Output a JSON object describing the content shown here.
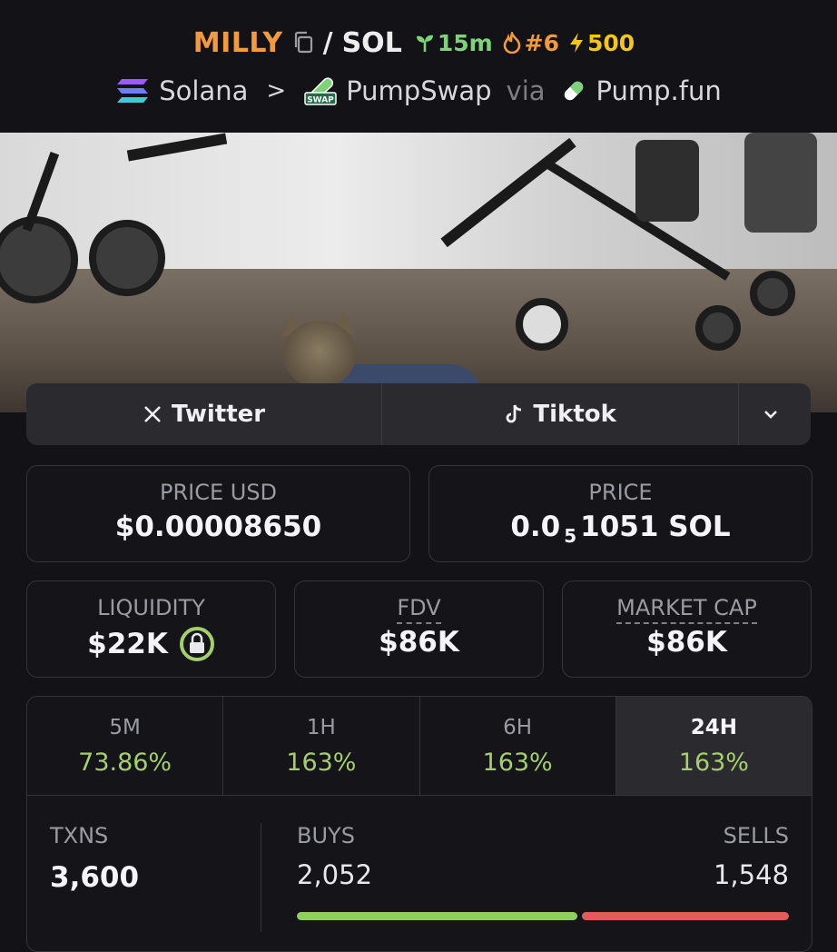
{
  "header": {
    "token_symbol": "MILLY",
    "separator": "/",
    "quote_symbol": "SOL",
    "age_badge": "15m",
    "rank_badge": "#6",
    "boost_badge": "500",
    "chain": "Solana",
    "dex": "PumpSwap",
    "via_label": "via",
    "launchpad": "Pump.fun",
    "swap_icon_text": "SWAP"
  },
  "socials": {
    "twitter_label": "Twitter",
    "tiktok_label": "Tiktok"
  },
  "metrics": {
    "price_usd_label": "PRICE USD",
    "price_usd_value": "$0.00008650",
    "price_label": "PRICE",
    "price_prefix": "0.0",
    "price_subscript": "5",
    "price_suffix": "1051 SOL",
    "liquidity_label": "LIQUIDITY",
    "liquidity_value": "$22K",
    "fdv_label": "FDV",
    "fdv_value": "$86K",
    "mcap_label": "MARKET CAP",
    "mcap_value": "$86K"
  },
  "timeframes": [
    {
      "label": "5M",
      "value": "73.86%"
    },
    {
      "label": "1H",
      "value": "163%"
    },
    {
      "label": "6H",
      "value": "163%"
    },
    {
      "label": "24H",
      "value": "163%"
    }
  ],
  "transactions": {
    "txns_label": "TXNS",
    "txns_value": "3,600",
    "buys_label": "BUYS",
    "buys_value": "2,052",
    "sells_label": "SELLS",
    "sells_value": "1,548",
    "buy_fraction": 0.57
  },
  "colors": {
    "accent_orange": "#f19a3e",
    "positive_green": "#a3d06a",
    "buy_bar": "#8fcf5e",
    "sell_bar": "#e35c5c"
  }
}
